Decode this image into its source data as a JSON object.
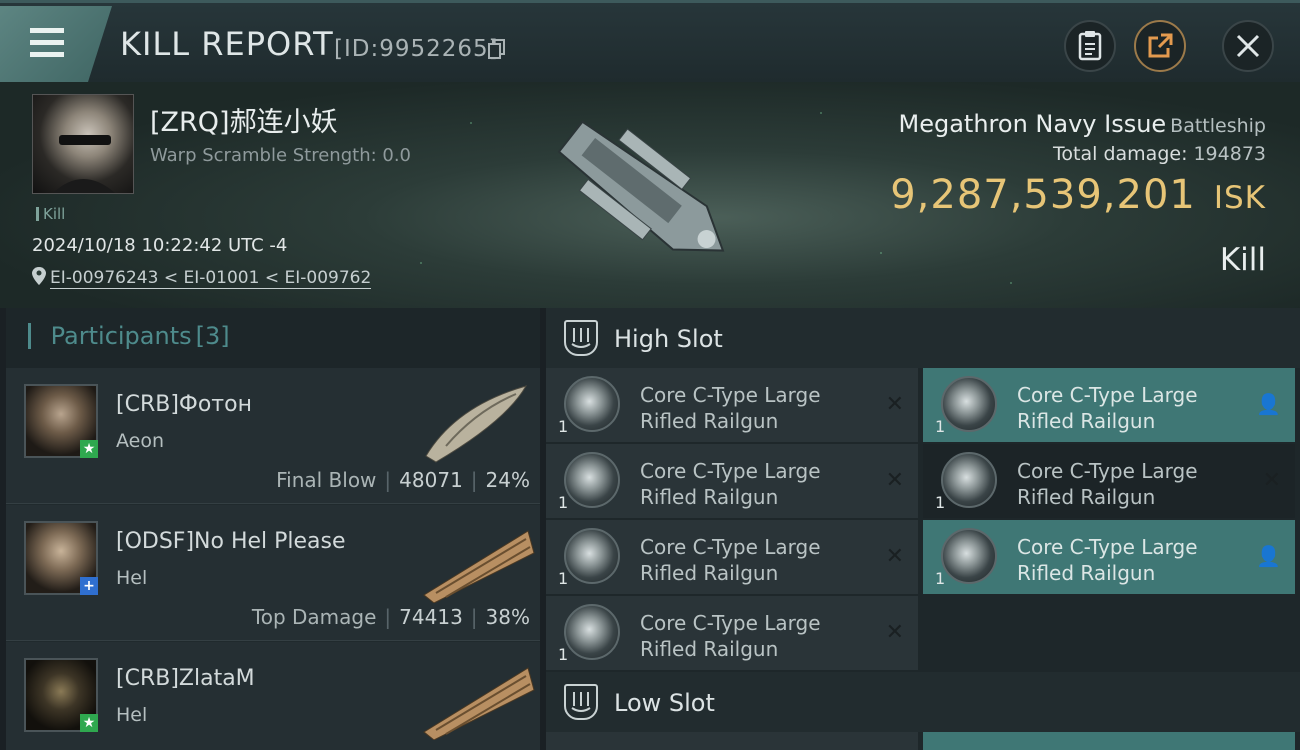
{
  "header": {
    "title": "KILL REPORT",
    "report_id": "[ID:9952265]",
    "icons": [
      "menu-icon",
      "copy-icon",
      "clipboard-icon",
      "share-icon",
      "close-icon"
    ]
  },
  "victim": {
    "name": "[ZRQ]郝连小妖",
    "warp": "Warp Scramble Strength: 0.0",
    "tag": "Kill",
    "datetime": "2024/10/18 10:22:42 UTC -4",
    "location": "EI-00976243 < EI-01001 < EI-009762",
    "ship_name": "Megathron Navy Issue",
    "ship_class": "Battleship",
    "total_damage_label": "Total damage:",
    "total_damage": "194873",
    "isk_value": "9,287,539,201",
    "isk_unit": "ISK",
    "result": "Kill"
  },
  "participants": {
    "label": "Participants",
    "count": "[3]",
    "rows": [
      {
        "name": "[CRB]Фотон",
        "ship": "Aeon",
        "role": "Final Blow",
        "damage": "48071",
        "pct": "24%",
        "badge": "★"
      },
      {
        "name": "[ODSF]No Hel Please",
        "ship": "Hel",
        "role": "Top Damage",
        "damage": "74413",
        "pct": "38%",
        "badge": "+"
      },
      {
        "name": "[CRB]ZlataM",
        "ship": "Hel",
        "role": "",
        "damage": "",
        "pct": "",
        "badge": "★"
      }
    ]
  },
  "slots": {
    "high_title": "High Slot",
    "low_title": "Low Slot",
    "module_line1": "Core C-Type Large",
    "module_line2": "Rifled Railgun",
    "qty": "1"
  },
  "colors": {
    "accent": "#4e8b8c",
    "isk": "#e7c577",
    "active_slot": "#3f7775"
  }
}
